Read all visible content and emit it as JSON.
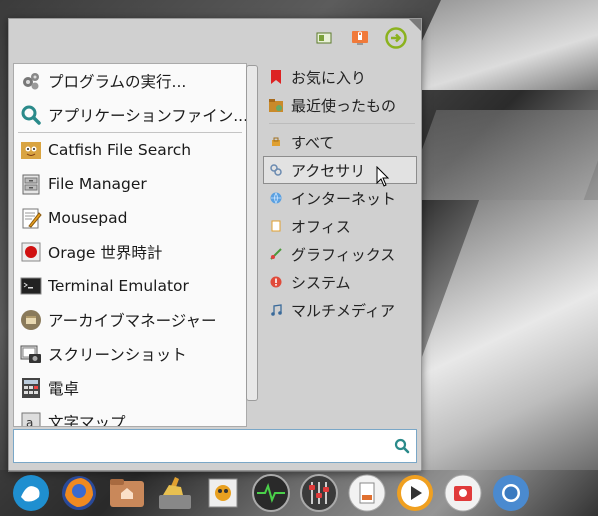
{
  "menu": {
    "left_items": [
      {
        "label": "プログラムの実行...",
        "icon": "gears-icon"
      },
      {
        "label": "アプリケーションファイン...",
        "icon": "search-icon"
      },
      {
        "label": "Catfish File Search",
        "icon": "catfish-icon"
      },
      {
        "label": "File Manager",
        "icon": "file-manager-icon"
      },
      {
        "label": "Mousepad",
        "icon": "mousepad-icon"
      },
      {
        "label": "Orage 世界時計",
        "icon": "clock-icon"
      },
      {
        "label": "Terminal Emulator",
        "icon": "terminal-icon"
      },
      {
        "label": "アーカイブマネージャー",
        "icon": "archive-icon"
      },
      {
        "label": "スクリーンショット",
        "icon": "screenshot-icon"
      },
      {
        "label": "電卓",
        "icon": "calculator-icon"
      },
      {
        "label": "文字マップ",
        "icon": "charmap-icon"
      }
    ],
    "right_top": [
      {
        "label": "お気に入り",
        "icon": "bookmark-icon"
      },
      {
        "label": "最近使ったもの",
        "icon": "recent-icon"
      }
    ],
    "categories": [
      {
        "label": "すべて",
        "icon": "all-icon"
      },
      {
        "label": "アクセサリ",
        "icon": "accessories-icon"
      },
      {
        "label": "インターネット",
        "icon": "globe-icon"
      },
      {
        "label": "オフィス",
        "icon": "office-icon"
      },
      {
        "label": "グラフィックス",
        "icon": "graphics-icon"
      },
      {
        "label": "システム",
        "icon": "system-icon"
      },
      {
        "label": "マルチメディア",
        "icon": "music-icon"
      }
    ],
    "selected_category": "アクセサリ",
    "search": {
      "value": "",
      "placeholder": ""
    }
  },
  "colors": {
    "accent": "#7aa7c7",
    "logout": "#8bb21e"
  },
  "dock": [
    "whisker-icon",
    "firefox-icon",
    "home-folder-icon",
    "cleaner-icon",
    "photos-icon",
    "activity-icon",
    "mixer-icon",
    "document-icon",
    "media-player-icon",
    "app-store-icon",
    "chromium-icon"
  ]
}
